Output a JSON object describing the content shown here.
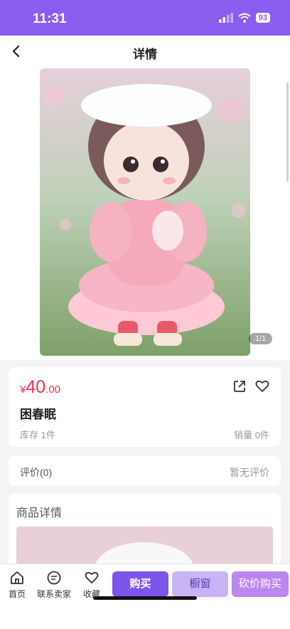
{
  "status": {
    "time": "11:31",
    "battery": "93"
  },
  "nav": {
    "title": "详情"
  },
  "gallery": {
    "counter": "1/1"
  },
  "product": {
    "currency": "¥",
    "price_int": "40",
    "price_dec": ".00",
    "name": "困春眠",
    "stock": "库存 1件",
    "sales": "销量 0件"
  },
  "reviews": {
    "label": "评价(0)",
    "empty": "暂无评价"
  },
  "details": {
    "title": "商品详情"
  },
  "bottom": {
    "home": "首页",
    "contact": "联系卖家",
    "favorite": "收藏",
    "buy": "购买",
    "window": "橱窗",
    "bargain": "砍价购买"
  },
  "colors": {
    "accent": "#8a5cf0",
    "price": "#f0344b"
  }
}
